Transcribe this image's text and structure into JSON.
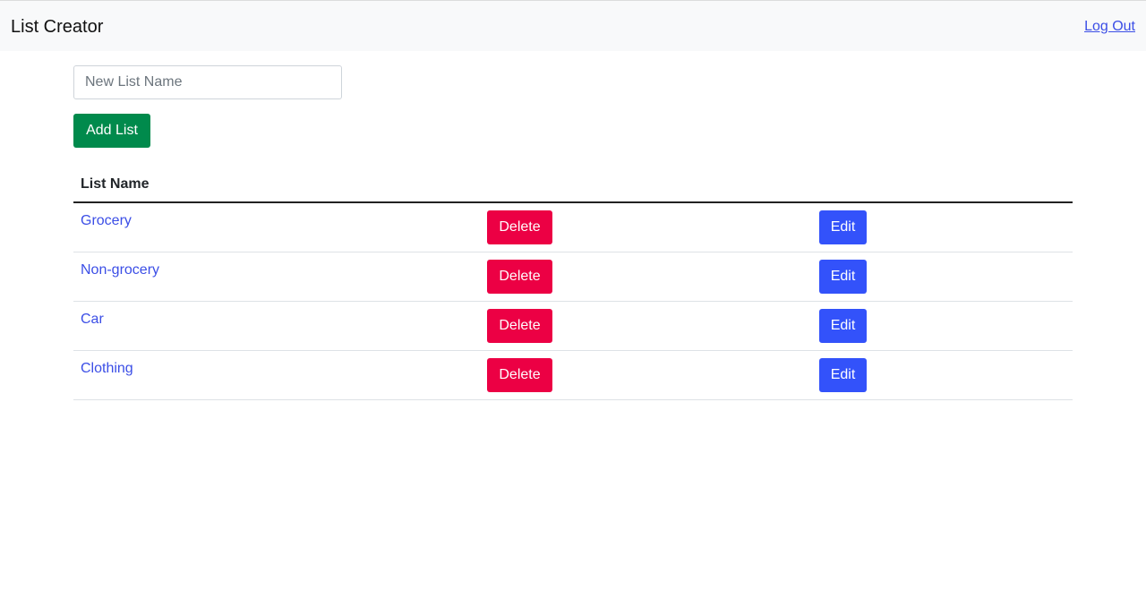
{
  "navbar": {
    "brand": "List Creator",
    "logout_label": "Log Out"
  },
  "form": {
    "input_placeholder": "New List Name",
    "input_value": "",
    "add_button_label": "Add List"
  },
  "table": {
    "header": "List Name",
    "rows": [
      {
        "name": "Grocery",
        "delete_label": "Delete",
        "edit_label": "Edit"
      },
      {
        "name": "Non-grocery",
        "delete_label": "Delete",
        "edit_label": "Edit"
      },
      {
        "name": "Car",
        "delete_label": "Delete",
        "edit_label": "Edit"
      },
      {
        "name": "Clothing",
        "delete_label": "Delete",
        "edit_label": "Edit"
      }
    ]
  },
  "colors": {
    "add_button": "#008a4c",
    "delete_button": "#ec0044",
    "edit_button": "#3352fa",
    "link": "#3b4ee6",
    "navbar_bg": "#f8f9fa"
  }
}
